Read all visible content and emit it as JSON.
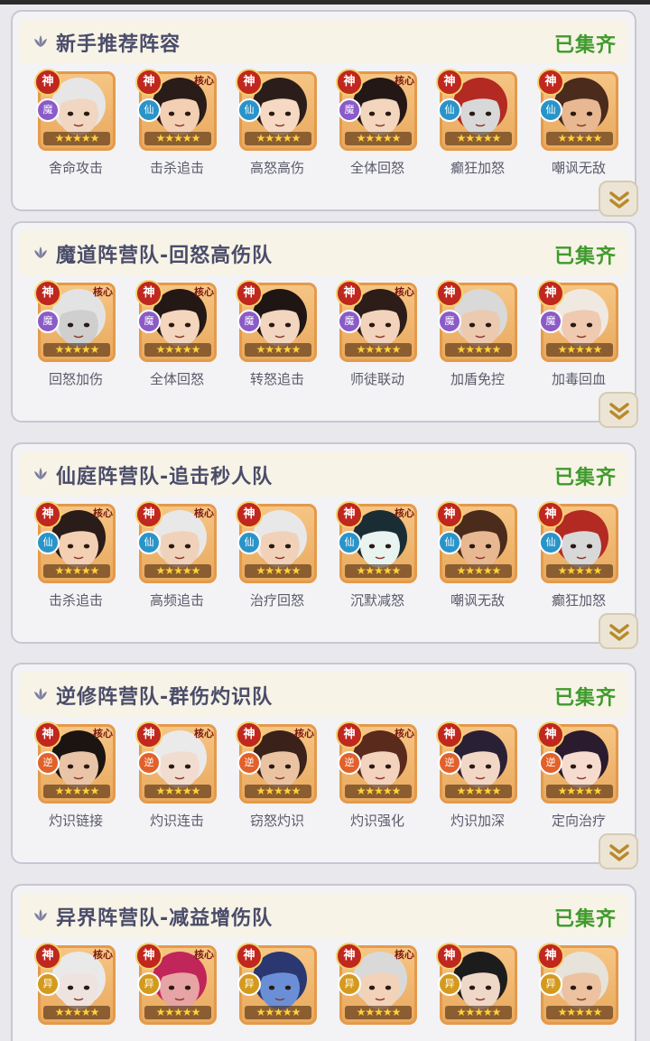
{
  "cards": [
    {
      "title": "新手推荐阵容",
      "status": "已集齐",
      "heroes": [
        {
          "god": "神",
          "faction": "魔",
          "core": "",
          "skill": "舍命攻击",
          "stars": "★★★★★",
          "skin": "#f1d6c2",
          "hair": "#e6e6e6",
          "faction_key": "mo"
        },
        {
          "god": "神",
          "faction": "仙",
          "core": "核心",
          "skill": "击杀追击",
          "stars": "★★★★★",
          "skin": "#f3d0b4",
          "hair": "#2a1c18",
          "faction_key": "xian"
        },
        {
          "god": "神",
          "faction": "仙",
          "core": "",
          "skill": "高怒高伤",
          "stars": "★★★★★",
          "skin": "#f6d9c2",
          "hair": "#2b1e1a",
          "faction_key": "xian"
        },
        {
          "god": "神",
          "faction": "魔",
          "core": "核心",
          "skill": "全体回怒",
          "stars": "★★★★★",
          "skin": "#f4d5bd",
          "hair": "#231815",
          "faction_key": "mo"
        },
        {
          "god": "神",
          "faction": "仙",
          "core": "",
          "skill": "癫狂加怒",
          "stars": "★★★★★",
          "skin": "#d8d8d8",
          "hair": "#b22a22",
          "faction_key": "xian"
        },
        {
          "god": "神",
          "faction": "仙",
          "core": "",
          "skill": "嘲讽无敌",
          "stars": "★★★★★",
          "skin": "#e8b892",
          "hair": "#4a2b1c",
          "faction_key": "xian"
        }
      ]
    },
    {
      "title": "魔道阵营队-回怒高伤队",
      "status": "已集齐",
      "heroes": [
        {
          "god": "神",
          "faction": "魔",
          "core": "核心",
          "skill": "回怒加伤",
          "stars": "★★★★★",
          "skin": "#cfcfcf",
          "hair": "#e3e3e3",
          "faction_key": "mo"
        },
        {
          "god": "神",
          "faction": "魔",
          "core": "核心",
          "skill": "全体回怒",
          "stars": "★★★★★",
          "skin": "#f4d5bd",
          "hair": "#231815",
          "faction_key": "mo"
        },
        {
          "god": "神",
          "faction": "魔",
          "core": "",
          "skill": "转怒追击",
          "stars": "★★★★★",
          "skin": "#f3d6c0",
          "hair": "#1f1614",
          "faction_key": "mo"
        },
        {
          "god": "神",
          "faction": "魔",
          "core": "核心",
          "skill": "师徒联动",
          "stars": "★★★★★",
          "skin": "#f3d3bb",
          "hair": "#2c1d18",
          "faction_key": "mo"
        },
        {
          "god": "神",
          "faction": "魔",
          "core": "",
          "skill": "加盾免控",
          "stars": "★★★★★",
          "skin": "#eccab0",
          "hair": "#d9d9d9",
          "faction_key": "mo"
        },
        {
          "god": "神",
          "faction": "魔",
          "core": "",
          "skill": "加毒回血",
          "stars": "★★★★★",
          "skin": "#efc9b0",
          "hair": "#efe9e2",
          "faction_key": "mo"
        }
      ]
    },
    {
      "title": "仙庭阵营队-追击秒人队",
      "status": "已集齐",
      "heroes": [
        {
          "god": "神",
          "faction": "仙",
          "core": "核心",
          "skill": "击杀追击",
          "stars": "★★★★★",
          "skin": "#f3d0b4",
          "hair": "#2a1c18",
          "faction_key": "xian"
        },
        {
          "god": "神",
          "faction": "仙",
          "core": "核心",
          "skill": "高频追击",
          "stars": "★★★★★",
          "skin": "#f0d2bb",
          "hair": "#e8e8e8",
          "faction_key": "xian"
        },
        {
          "god": "神",
          "faction": "仙",
          "core": "",
          "skill": "治疗回怒",
          "stars": "★★★★★",
          "skin": "#f1d2b9",
          "hair": "#e8e8e8",
          "faction_key": "xian"
        },
        {
          "god": "神",
          "faction": "仙",
          "core": "核心",
          "skill": "沉默减怒",
          "stars": "★★★★★",
          "skin": "#e9f4f1",
          "hair": "#1b2d34",
          "faction_key": "xian"
        },
        {
          "god": "神",
          "faction": "仙",
          "core": "",
          "skill": "嘲讽无敌",
          "stars": "★★★★★",
          "skin": "#e8b892",
          "hair": "#4a2b1c",
          "faction_key": "xian"
        },
        {
          "god": "神",
          "faction": "仙",
          "core": "",
          "skill": "癫狂加怒",
          "stars": "★★★★★",
          "skin": "#d8d8d8",
          "hair": "#b22a22",
          "faction_key": "xian"
        }
      ]
    },
    {
      "title": "逆修阵营队-群伤灼识队",
      "status": "已集齐",
      "heroes": [
        {
          "god": "神",
          "faction": "逆",
          "core": "核心",
          "skill": "灼识链接",
          "stars": "★★★★★",
          "skin": "#e9c4a6",
          "hair": "#1b1410",
          "faction_key": "ni"
        },
        {
          "god": "神",
          "faction": "逆",
          "core": "核心",
          "skill": "灼识连击",
          "stars": "★★★★★",
          "skin": "#f2dcd0",
          "hair": "#eaeaea",
          "faction_key": "ni"
        },
        {
          "god": "神",
          "faction": "逆",
          "core": "核心",
          "skill": "窃怒灼识",
          "stars": "★★★★★",
          "skin": "#eac3a3",
          "hair": "#3a221a",
          "faction_key": "ni"
        },
        {
          "god": "神",
          "faction": "逆",
          "core": "核心",
          "skill": "灼识强化",
          "stars": "★★★★★",
          "skin": "#f3d3bd",
          "hair": "#5a2a1c",
          "faction_key": "ni"
        },
        {
          "god": "神",
          "faction": "逆",
          "core": "",
          "skill": "灼识加深",
          "stars": "★★★★★",
          "skin": "#f3d7c6",
          "hair": "#2a2036",
          "faction_key": "ni"
        },
        {
          "god": "神",
          "faction": "逆",
          "core": "",
          "skill": "定向治疗",
          "stars": "★★★★★",
          "skin": "#f6dccf",
          "hair": "#2a1c2e",
          "faction_key": "ni"
        }
      ]
    },
    {
      "title": "异界阵营队-减益增伤队",
      "status": "已集齐",
      "heroes": [
        {
          "god": "神",
          "faction": "异",
          "core": "核心",
          "skill": "",
          "stars": "★★★★★",
          "skin": "#efe3df",
          "hair": "#e9e9ea",
          "faction_key": "yi"
        },
        {
          "god": "神",
          "faction": "异",
          "core": "核心",
          "skill": "",
          "stars": "★★★★★",
          "skin": "#e6a4a4",
          "hair": "#c0265a",
          "faction_key": "yi"
        },
        {
          "god": "神",
          "faction": "异",
          "core": "",
          "skill": "",
          "stars": "★★★★★",
          "skin": "#6b8fd6",
          "hair": "#2a3770",
          "faction_key": "yi"
        },
        {
          "god": "神",
          "faction": "异",
          "core": "核心",
          "skill": "",
          "stars": "★★★★★",
          "skin": "#f3d2ba",
          "hair": "#d9d9d9",
          "faction_key": "yi"
        },
        {
          "god": "神",
          "faction": "异",
          "core": "",
          "skill": "",
          "stars": "★★★★★",
          "skin": "#f0d8c8",
          "hair": "#1c1c1c",
          "faction_key": "yi"
        },
        {
          "god": "神",
          "faction": "异",
          "core": "",
          "skill": "",
          "stars": "★★★★★",
          "skin": "#ecc2a0",
          "hair": "#e7e2da",
          "faction_key": "yi"
        }
      ]
    }
  ],
  "colors": {
    "status_green": "#3f9a2c",
    "title": "#4a4c6a",
    "frame_orange": "#e49a4a",
    "god_red": "#c0271f"
  },
  "icons": {
    "header": "lotus-icon",
    "expand": "double-chevron-down-icon"
  }
}
